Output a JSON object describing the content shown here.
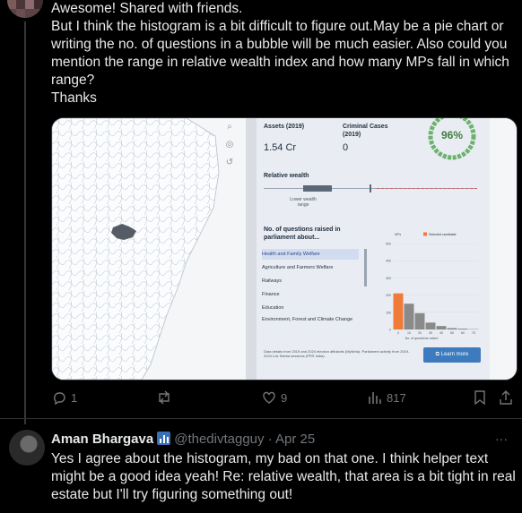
{
  "tweet": {
    "lines": [
      "Awesome! Shared with friends.",
      "But I think the histogram is a bit difficult to figure out.May be a pie chart or",
      "writing the no. of questions in a bubble will be much easier. Also could you",
      "mention the range in relative wealth index and how many MPs fall in which",
      "range?",
      "Thanks"
    ],
    "actions": {
      "replies": "1",
      "retweets": "",
      "likes": "9",
      "views": "817"
    }
  },
  "embed": {
    "assets_label": "Assets (2019)",
    "assets_value": "1.54 Cr",
    "criminal_label": "Criminal Cases (2019)",
    "criminal_value": "0",
    "attendance_pct": "96%",
    "relative_wealth_label": "Relative wealth",
    "lower_label": "Lower wealth range",
    "questions_label": "No. of questions raised in parliament about...",
    "subjects": [
      "Health and Family Welfare",
      "Agriculture and Farmers Welfare",
      "Railways",
      "Finance",
      "Education",
      "Environment, Forest and Climate Change"
    ],
    "legend_mps": "MPs",
    "legend_selected": "Selected candidate",
    "x_axis_label": "No. of questions raised",
    "footnote": "Data details from 2019 and 2024 election affidavits (MyNeta). Parliament activity from 2019-2024 Lok Sabha sessions (PRS India).",
    "learn_more": "Learn more",
    "chart_data": {
      "type": "bar",
      "xlabel": "No. of questions raised",
      "ylabel": "",
      "x": [
        0,
        10,
        20,
        30,
        40,
        50,
        60,
        70
      ],
      "y_ticks": [
        0,
        100,
        200,
        300,
        400,
        500
      ],
      "series": [
        {
          "name": "MPs",
          "values": [
            210,
            150,
            95,
            40,
            20,
            8,
            5,
            2
          ]
        }
      ],
      "highlight_index": 0,
      "ylim": [
        0,
        500
      ],
      "colors": {
        "mps": "#8a8a8a",
        "selected": "#f07a3a"
      }
    }
  },
  "reply": {
    "name": "Aman Bhargava",
    "handle": "@thedivtagguy",
    "dot": "·",
    "date": "Apr 25",
    "more": "···",
    "lines": [
      "Yes I agree about the histogram, my bad on that one. I think helper text",
      "might be a good idea yeah! Re: relative wealth, that area is a bit tight in real",
      "estate but I'll try figuring something out!"
    ]
  }
}
